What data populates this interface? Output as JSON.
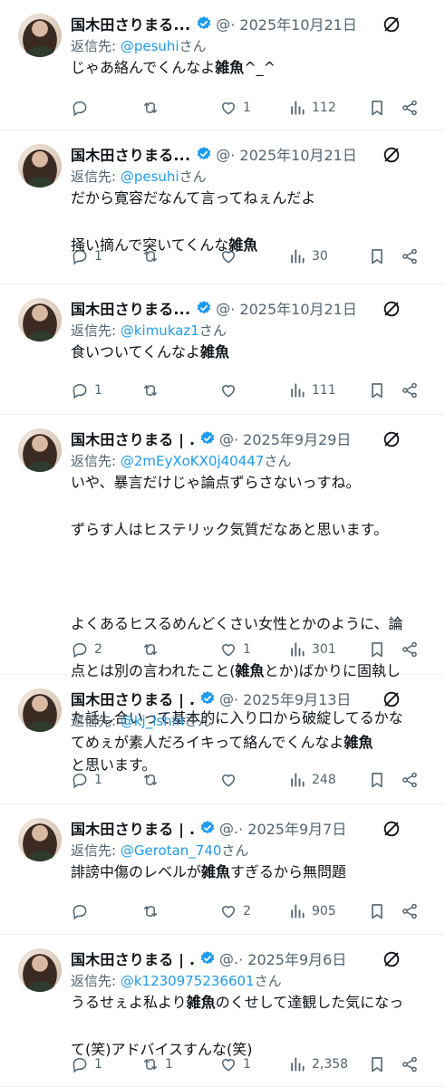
{
  "colors": {
    "accent": "#1d9bf0",
    "muted": "#536471",
    "text": "#0f1419"
  },
  "tweets": [
    {
      "name": "国木田さりまる...",
      "handle": "@",
      "date": "· 2025年10月21日",
      "reply_label": "返信先:",
      "reply_to": "@pesuhi",
      "reply_suffix": "さん",
      "lines": [
        {
          "pre": "じゃあ絡んでくんなよ",
          "bold": "雑魚",
          "post": "^_^"
        }
      ],
      "replies": "",
      "retweets": "",
      "likes": "1",
      "views": "112"
    },
    {
      "name": "国木田さりまる...",
      "handle": "@",
      "date": "· 2025年10月21日",
      "reply_label": "返信先:",
      "reply_to": "@pesuhi",
      "reply_suffix": "さん",
      "lines": [
        {
          "pre": "だから寛容だなんて言ってねぇんだよ",
          "bold": "",
          "post": ""
        },
        {
          "pre": "掻い摘んで突いてくんな",
          "bold": "雑魚",
          "post": ""
        }
      ],
      "replies": "1",
      "retweets": "",
      "likes": "",
      "views": "30"
    },
    {
      "name": "国木田さりまる...",
      "handle": "@",
      "date": "· 2025年10月21日",
      "reply_label": "返信先:",
      "reply_to": "@kimukaz1",
      "reply_suffix": "さん",
      "lines": [
        {
          "pre": "食いついてくんなよ",
          "bold": "雑魚",
          "post": ""
        }
      ],
      "replies": "1",
      "retweets": "",
      "likes": "",
      "views": "111"
    },
    {
      "name": "国木田さりまる | ...",
      "handle": "@",
      "date": "· 2025年9月29日",
      "reply_label": "返信先:",
      "reply_to": "@2mEyXoKX0j40447",
      "reply_suffix": "さん",
      "lines": [
        {
          "pre": "いや、暴言だけじゃ論点ずらさないっすね。",
          "bold": "",
          "post": ""
        },
        {
          "pre": "ずらす人はヒステリック気質だなあと思います。",
          "bold": "",
          "post": ""
        },
        {
          "pre": "",
          "bold": "",
          "post": ""
        },
        {
          "pre": "よくあるヒスるめんどくさい女性とかのように、論",
          "bold": "",
          "post": ""
        },
        {
          "pre": "点とは別の言われたこと(",
          "bold": "雑魚",
          "post": "とか)ばかりに固執し"
        },
        {
          "pre": "た話し合いって基本的に入り口から破綻してるかな",
          "bold": "",
          "post": ""
        },
        {
          "pre": "と思います。",
          "bold": "",
          "post": ""
        }
      ],
      "replies": "2",
      "retweets": "",
      "likes": "1",
      "views": "301"
    },
    {
      "name": "国木田さりまる | ...",
      "handle": "@",
      "date": "· 2025年9月13日",
      "reply_label": "返信先:",
      "reply_to": "@kj_ishin",
      "reply_suffix": "さん",
      "lines": [
        {
          "pre": "てめぇが素人だろイキって絡んでくんなよ",
          "bold": "雑魚",
          "post": ""
        }
      ],
      "replies": "1",
      "retweets": "",
      "likes": "",
      "views": "248"
    },
    {
      "name": "国木田さりまる | ...",
      "handle": "@.",
      "date": "· 2025年9月7日",
      "reply_label": "返信先:",
      "reply_to": "@Gerotan_740",
      "reply_suffix": "さん",
      "lines": [
        {
          "pre": "誹謗中傷のレベルが",
          "bold": "雑魚",
          "post": "すぎるから無問題"
        }
      ],
      "replies": "",
      "retweets": "",
      "likes": "2",
      "views": "905"
    },
    {
      "name": "国木田さりまる | ...",
      "handle": "@.",
      "date": "· 2025年9月6日",
      "reply_label": "返信先:",
      "reply_to": "@k1230975236601",
      "reply_suffix": "さん",
      "lines": [
        {
          "pre": "うるせぇよ私より",
          "bold": "雑魚",
          "post": "のくせして達観した気になっ"
        },
        {
          "pre": "て(笑)アドバイスすんな(笑)",
          "bold": "",
          "post": ""
        }
      ],
      "replies": "1",
      "retweets": "1",
      "likes": "1",
      "views": "2,358"
    }
  ]
}
